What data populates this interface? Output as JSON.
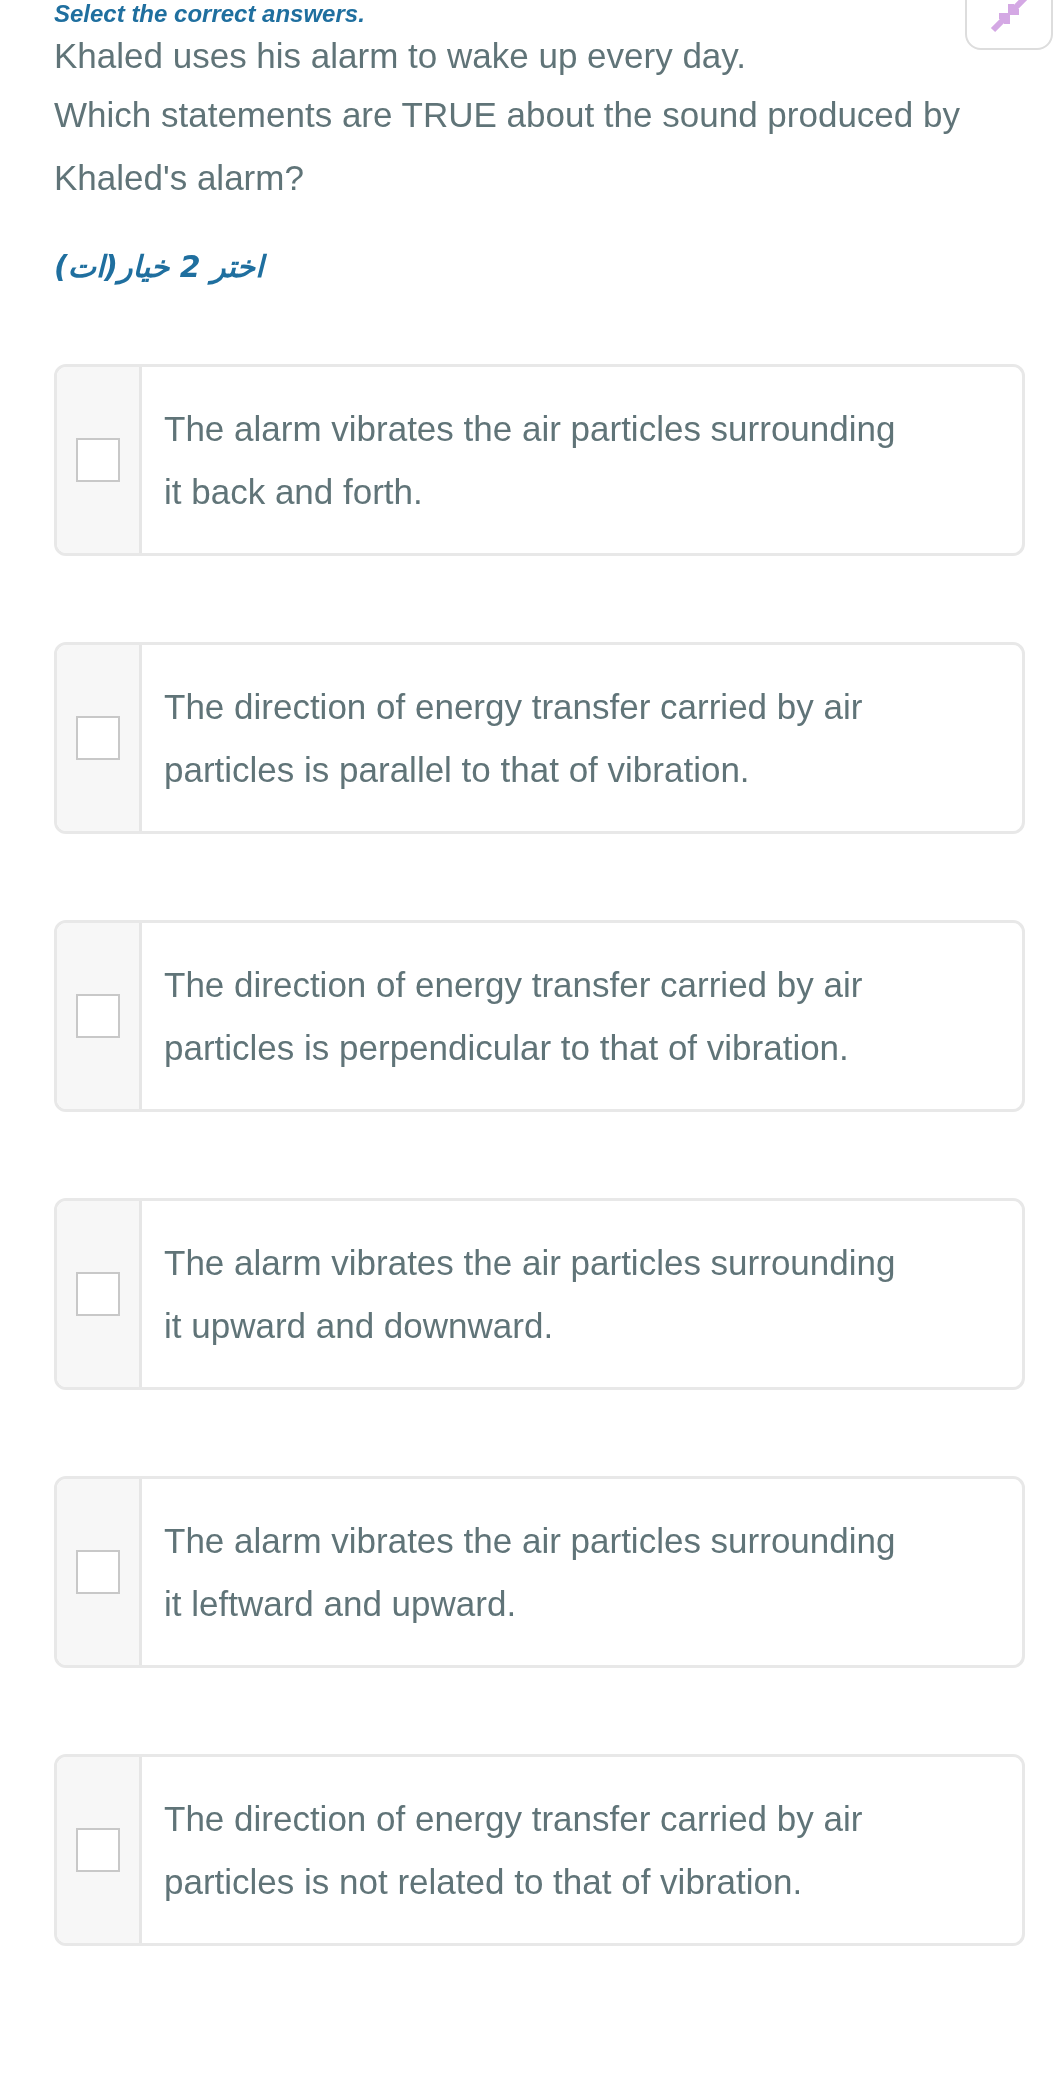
{
  "heading": "Select the correct answers.",
  "question": [
    "Khaled uses his alarm to wake up every day.",
    "Which statements are TRUE about the sound produced by Khaled's alarm?"
  ],
  "instruction": "اختر 2 خيار(ات)",
  "options": [
    {
      "text": "The alarm vibrates the air particles surrounding it back and forth.",
      "checked": false
    },
    {
      "text": "The direction of energy transfer carried by air particles is parallel to that of vibration.",
      "checked": false
    },
    {
      "text": "The direction of energy transfer carried by air particles is perpendicular to that of vibration.",
      "checked": false
    },
    {
      "text": "The alarm vibrates the air particles surrounding it upward and downward.",
      "checked": false
    },
    {
      "text": "The alarm vibrates the air particles surrounding it leftward and upward.",
      "checked": false
    },
    {
      "text": "The direction of energy transfer carried by air particles is not related to that of vibration.",
      "checked": false
    }
  ]
}
